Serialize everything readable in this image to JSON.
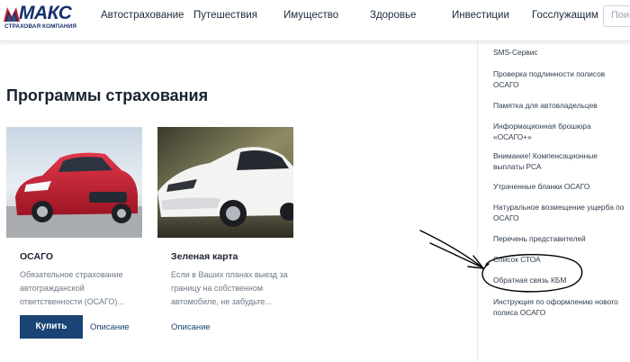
{
  "header": {
    "logo_text": "МАКС",
    "logo_subtitle": "СТРАХОВАЯ КОМПАНИЯ",
    "nav": [
      "Автострахование",
      "Путешествия",
      "Имущество",
      "Здоровье",
      "Инвестиции",
      "Госслужащим"
    ],
    "search_fragment": "Поиск"
  },
  "main": {
    "section_title": "Программы страхования",
    "cards": [
      {
        "title": "ОСАГО",
        "description": "Обязательное страхование автогражданской ответственности (ОСАГО)...",
        "buy_label": "Купить",
        "details_label": "Описание",
        "image": "red-car"
      },
      {
        "title": "Зеленая карта",
        "description": "Если в Ваших планах выезд за границу на собственном автомобиле, не забудьте...",
        "details_label": "Описание",
        "image": "white-car"
      }
    ]
  },
  "sidebar": {
    "items": [
      "SMS-Сервис",
      "Проверка подлинности полисов ОСАГО",
      "Памятка для автовладельцев",
      "Информационная брошюра «ОСАГО+»",
      "Внимание! Компенсационные выплаты РСА",
      "Утраченные бланки ОСАГО",
      "Натуральное возмещение ущерба по ОСАГО",
      "Перечень представителей",
      "Список СТОА",
      "Обратная связь КБМ",
      "Инструкция по оформлению нового полиса ОСАГО"
    ]
  },
  "colors": {
    "brand_blue": "#15306b",
    "button_blue": "#1a4376",
    "text_dark": "#1a2330",
    "text_muted": "#6d7884"
  },
  "annotation": {
    "type": "hand-drawn arrow and ellipse",
    "highlighted_item": "Обратная связь КБМ"
  }
}
